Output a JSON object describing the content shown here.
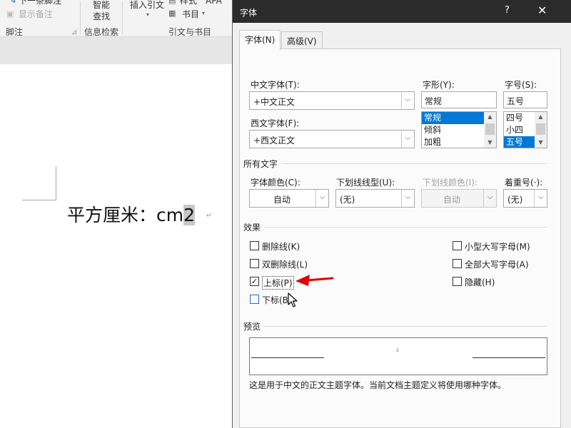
{
  "ribbon": {
    "footnote_next": "下一条脚注",
    "show_notes": "显示备注",
    "group_footnotes": "脚注",
    "smart_lookup_1": "智能",
    "smart_lookup_2": "查找",
    "group_info": "信息检索",
    "insert_citation": "插入引文",
    "style_label": "样式",
    "style_value": "APA",
    "bibliography": "书目",
    "group_citations": "引文与书目"
  },
  "document": {
    "text": "平方厘米：cm",
    "selected": "2",
    "para_mark": "↵"
  },
  "dialog": {
    "title": "字体",
    "help": "?",
    "close": "✕",
    "tabs": [
      {
        "label": "字体(N)"
      },
      {
        "label": "高级(V)"
      }
    ],
    "chinese_font_label": "中文字体(T):",
    "chinese_font_value": "+中文正文",
    "western_font_label": "西文字体(F):",
    "western_font_value": "+西文正文",
    "style_label": "字形(Y):",
    "style_value": "常规",
    "style_list": [
      "常规",
      "倾斜",
      "加粗"
    ],
    "size_label": "字号(S):",
    "size_value": "五号",
    "size_list": [
      "四号",
      "小四",
      "五号"
    ],
    "all_text_section": "所有文字",
    "font_color_label": "字体颜色(C):",
    "font_color_value": "自动",
    "underline_style_label": "下划线线型(U):",
    "underline_style_value": "(无)",
    "underline_color_label": "下划线颜色(I):",
    "underline_color_value": "自动",
    "emphasis_label": "着重号(·):",
    "emphasis_value": "(无)",
    "effects_section": "效果",
    "effects_left": [
      {
        "label": "删除线(K)",
        "checked": false
      },
      {
        "label": "双删除线(L)",
        "checked": false
      },
      {
        "label": "上标(P)",
        "checked": true
      },
      {
        "label": "下标(B)",
        "checked": false
      }
    ],
    "effects_right": [
      {
        "label": "小型大写字母(M)",
        "checked": false
      },
      {
        "label": "全部大写字母(A)",
        "checked": false
      },
      {
        "label": "隐藏(H)",
        "checked": false
      }
    ],
    "preview_section": "预览",
    "preview_mark": "2",
    "preview_note": "这是用于中文的正文主题字体。当前文档主题定义将使用哪种字体。"
  },
  "colors": {
    "accent": "#0078d7",
    "titlebar": "#2b2b2b",
    "annotation_arrow": "#e00000"
  },
  "icons": {
    "check": "✓",
    "dropdown": "chevron-down-icon",
    "scroll_up": "▲",
    "scroll_down": "▼"
  }
}
